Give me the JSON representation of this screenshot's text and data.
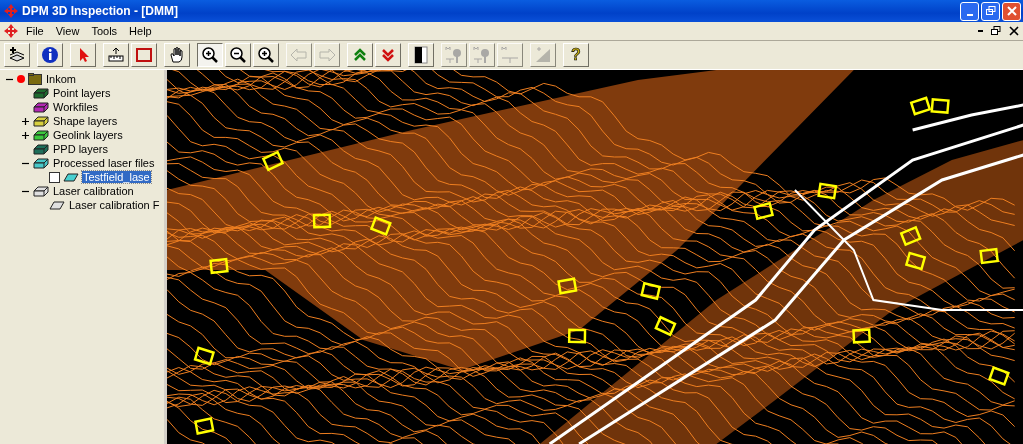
{
  "window": {
    "title": "DPM 3D Inspection - [DMM]"
  },
  "menu": [
    "File",
    "View",
    "Tools",
    "Help"
  ],
  "toolbar": [
    [
      {
        "kind": "add-layer",
        "disabled": false,
        "pressed": false
      }
    ],
    [
      {
        "kind": "info",
        "disabled": false,
        "pressed": false
      }
    ],
    [
      {
        "kind": "pointer",
        "disabled": false,
        "pressed": false
      }
    ],
    [
      {
        "kind": "measure",
        "disabled": false,
        "pressed": false
      },
      {
        "kind": "frame",
        "disabled": false,
        "pressed": false
      }
    ],
    [
      {
        "kind": "pan",
        "disabled": false,
        "pressed": false
      }
    ],
    [
      {
        "kind": "zoom-in",
        "disabled": false,
        "pressed": true
      },
      {
        "kind": "zoom-out",
        "disabled": false,
        "pressed": false
      },
      {
        "kind": "zoom-fit",
        "disabled": false,
        "pressed": false
      }
    ],
    [
      {
        "kind": "back",
        "disabled": true,
        "pressed": false
      },
      {
        "kind": "forward",
        "disabled": true,
        "pressed": false
      }
    ],
    [
      {
        "kind": "up",
        "disabled": false,
        "pressed": false
      },
      {
        "kind": "down",
        "disabled": false,
        "pressed": false
      }
    ],
    [
      {
        "kind": "contrast",
        "disabled": false,
        "pressed": false
      }
    ],
    [
      {
        "kind": "tree-m",
        "disabled": true,
        "pressed": false
      },
      {
        "kind": "tree-m2",
        "disabled": true,
        "pressed": false
      },
      {
        "kind": "ground-m",
        "disabled": true,
        "pressed": false
      }
    ],
    [
      {
        "kind": "slope",
        "disabled": true,
        "pressed": false
      }
    ],
    [
      {
        "kind": "help",
        "glyph": "?",
        "disabled": false,
        "pressed": false
      }
    ]
  ],
  "tree": [
    {
      "label": "Inkom",
      "kind": "folder",
      "active": true,
      "expanded": true,
      "selected": false,
      "children": [
        {
          "label": "Point layers",
          "kind": "layer",
          "color": "#1e6b2e",
          "selected": false
        },
        {
          "label": "Workfiles",
          "kind": "layer",
          "color": "#b428b4",
          "selected": false
        },
        {
          "label": "Shape layers",
          "kind": "layer",
          "color": "#d8d040",
          "expanded": false,
          "selected": false
        },
        {
          "label": "Geolink layers",
          "kind": "layer",
          "color": "#3cc83c",
          "expanded": false,
          "selected": false
        },
        {
          "label": "PPD layers",
          "kind": "layer",
          "color": "#1e6e5a",
          "selected": false
        },
        {
          "label": "Processed laser files",
          "kind": "layer",
          "color": "#48c8c8",
          "expanded": true,
          "selected": false,
          "children": [
            {
              "label": "Testfield_lase",
              "kind": "sheet",
              "color": "#48d0d0",
              "checked": false,
              "selected": true
            }
          ]
        },
        {
          "label": "Laser calibration",
          "kind": "layer",
          "color": "#e0e0e0",
          "expanded": true,
          "selected": false,
          "children": [
            {
              "label": "Laser calibration F",
              "kind": "sheet",
              "color": "#e0e0e0",
              "selected": false
            }
          ]
        }
      ]
    }
  ]
}
